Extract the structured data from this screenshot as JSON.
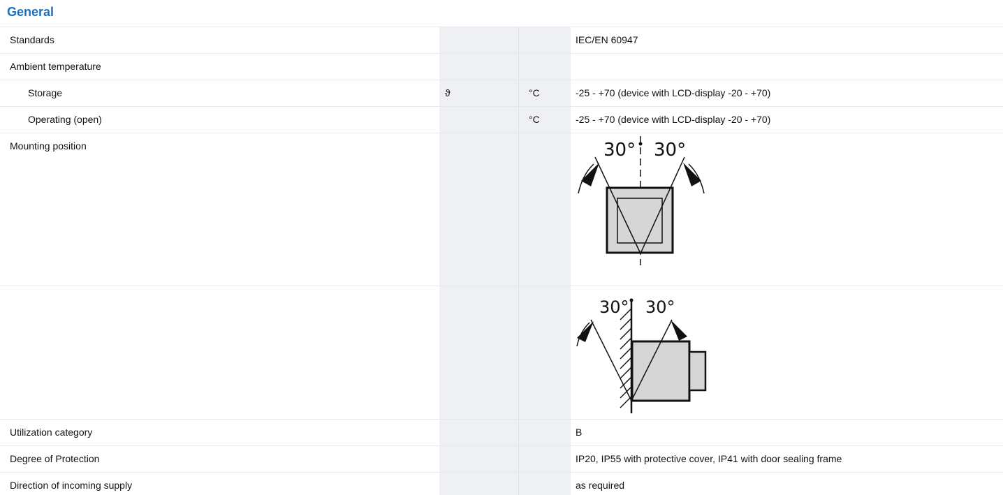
{
  "section": {
    "title": "General"
  },
  "rows": [
    {
      "label": "Standards",
      "symbol": "",
      "unit": "",
      "value": "IEC/EN 60947"
    },
    {
      "label": "Ambient temperature",
      "symbol": "",
      "unit": "",
      "value": ""
    },
    {
      "label": "Storage",
      "symbol": "ϑ",
      "unit": "°C",
      "value": "-25 - +70 (device with LCD-display -20 - +70)"
    },
    {
      "label": "Operating (open)",
      "symbol": "",
      "unit": "°C",
      "value": "-25 - +70 (device with LCD-display -20 - +70)"
    },
    {
      "label": "Mounting position",
      "symbol": "",
      "unit": "",
      "value": ""
    },
    {
      "label": "",
      "symbol": "",
      "unit": "",
      "value": ""
    },
    {
      "label": "Utilization category",
      "symbol": "",
      "unit": "",
      "value": "B"
    },
    {
      "label": "Degree of Protection",
      "symbol": "",
      "unit": "",
      "value": "IP20, IP55 with protective cover, IP41 with door sealing frame"
    },
    {
      "label": "Direction of incoming supply",
      "symbol": "",
      "unit": "",
      "value": "as required"
    }
  ],
  "diagrams": {
    "front": {
      "angle_left": "30°",
      "angle_right": "30°"
    },
    "side": {
      "angle_left": "30°",
      "angle_right": "30°"
    }
  }
}
